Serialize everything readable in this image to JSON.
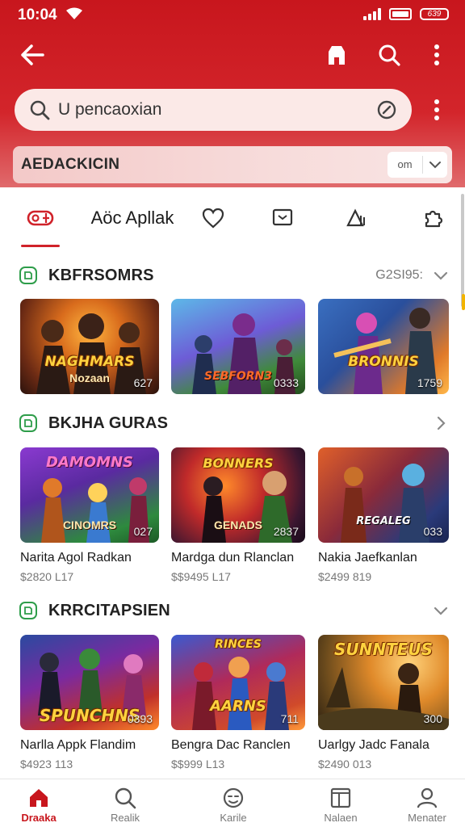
{
  "status_bar": {
    "time": "10:04",
    "battery_label": "639"
  },
  "search": {
    "value": "U pencaoxian"
  },
  "filter": {
    "label": "AEDACKICIN",
    "select_value": "om"
  },
  "tabs": [
    {
      "label": "",
      "icon": "gamepad-icon"
    },
    {
      "label": "Aöc Apllak",
      "icon": ""
    },
    {
      "label": "",
      "icon": "heart-icon"
    },
    {
      "label": "",
      "icon": "picture-icon"
    },
    {
      "label": "",
      "icon": "tree-icon"
    },
    {
      "label": "",
      "icon": "puzzle-icon"
    }
  ],
  "sections": [
    {
      "title": "KBFRSOMRS",
      "extra": "G2SI95:",
      "cards": [
        {
          "logo": "NAGHMARS",
          "sub": "Nozaan",
          "count": "627"
        },
        {
          "logo": "SEBFORN3",
          "sub": "",
          "count": "0333"
        },
        {
          "logo": "BRONNIS",
          "sub": "",
          "count": "1759"
        }
      ]
    },
    {
      "title": "BKJHA GURAS",
      "extra": "",
      "cards": [
        {
          "logo": "DAMOMNS",
          "sub": "CINOMRS",
          "count": "027",
          "title": "Narita Agol Radkan",
          "price": "$2820 L17"
        },
        {
          "logo": "BONNERS",
          "sub": "GENADS",
          "count": "2837",
          "title": "Mardga dun Rlanclan",
          "price": "$$9495 L17"
        },
        {
          "logo": "REGALEG",
          "sub": "",
          "count": "033",
          "title": "Nakia Jaefkanlan",
          "price": "$2499 819"
        }
      ]
    },
    {
      "title": "KRRCITAPSIEN",
      "extra": "",
      "cards": [
        {
          "logo": "SPUNCHNS",
          "sub": "",
          "count": "0393",
          "title": "Narlla Appk Flandim",
          "price": "$4923 113"
        },
        {
          "logo": "RINCES",
          "sub": "AARNS",
          "count": "711",
          "title": "Bengra Dac Ranclen",
          "price": "$$999 L13"
        },
        {
          "logo": "SUNNTEUS",
          "sub": "",
          "count": "300",
          "title": "Uarlgy Jadc Fanala",
          "price": "$2490 013"
        }
      ]
    }
  ],
  "bottom_nav": [
    {
      "label": "Draaka",
      "icon": "home-icon",
      "active": true
    },
    {
      "label": "Realik",
      "icon": "search-icon",
      "active": false
    },
    {
      "label": "Karile",
      "icon": "face-icon",
      "active": false
    },
    {
      "label": "Nalaen",
      "icon": "book-icon",
      "active": false
    },
    {
      "label": "Menater",
      "icon": "person-icon",
      "active": false
    }
  ],
  "colors": {
    "brand_red": "#c8161d",
    "section_badge_green": "#2e9d4a"
  }
}
